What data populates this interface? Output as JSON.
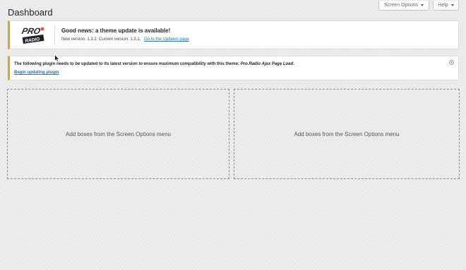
{
  "header": {
    "title": "Dashboard",
    "screen_options_label": "Screen Options",
    "help_label": "Help"
  },
  "theme_notice": {
    "logo_text_top": "PRO",
    "logo_text_bottom": "RADIO",
    "heading": "Good news: a theme update is available!",
    "message": "New version: 1.3.2. Current version: 1.3.1.",
    "link_label": "Go to the Updates page",
    "accent_color": "#dba617"
  },
  "plugin_notice": {
    "message": "The following plugin needs to be updated to its latest version to ensure maximum compatibility with this theme:",
    "plugin_name": "Pro.Radio Ajax Page Load",
    "message_end": ".",
    "link_label": "Begin updating plugin",
    "dismiss_icon": "close-circle-icon"
  },
  "dashboard_boxes": [
    {
      "empty_text": "Add boxes from the Screen Options menu"
    },
    {
      "empty_text": "Add boxes from the Screen Options menu"
    }
  ],
  "colors": {
    "link": "#2271b1",
    "warning": "#dba617",
    "background": "#f0f0f1"
  }
}
